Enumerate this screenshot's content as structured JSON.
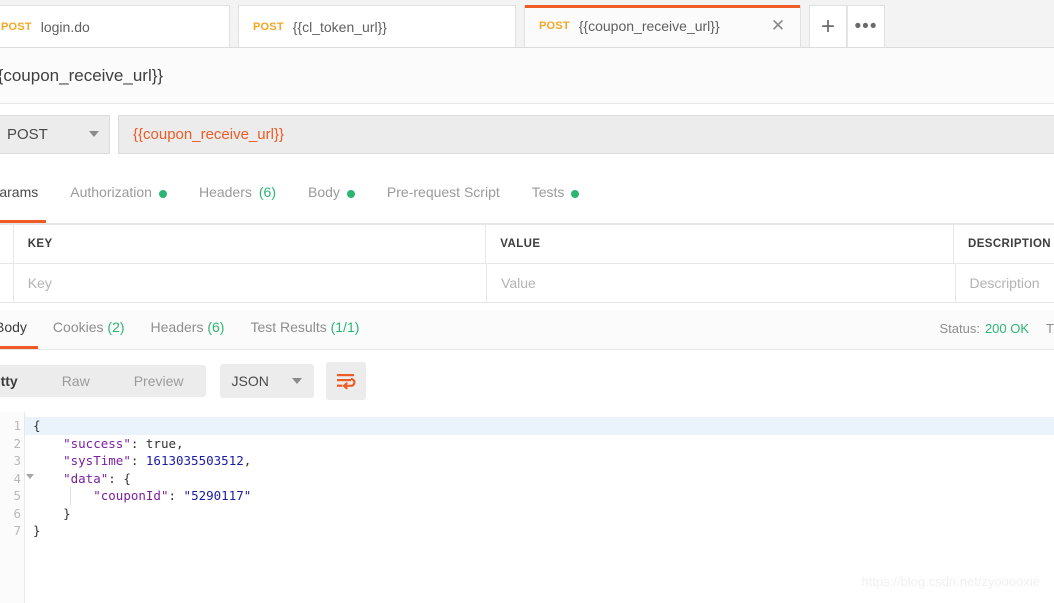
{
  "tabbar": {
    "tabs": [
      {
        "method": "POST",
        "title": "login.do",
        "active": false
      },
      {
        "method": "POST",
        "title": "{{cl_token_url}}",
        "active": false
      },
      {
        "method": "POST",
        "title": "{{coupon_receive_url}}",
        "active": true
      }
    ],
    "close_label": "✕",
    "new_tab_label": "+",
    "more_label": "•••"
  },
  "header": {
    "title": "{{coupon_receive_url}}"
  },
  "request": {
    "method": "POST",
    "url": "{{coupon_receive_url}}",
    "tabs": [
      {
        "label": "Params",
        "dot": false,
        "count": "",
        "active": true
      },
      {
        "label": "Authorization",
        "dot": true,
        "count": "",
        "active": false
      },
      {
        "label": "Headers",
        "dot": false,
        "count": "(6)",
        "active": false
      },
      {
        "label": "Body",
        "dot": true,
        "count": "",
        "active": false
      },
      {
        "label": "Pre-request Script",
        "dot": false,
        "count": "",
        "active": false
      },
      {
        "label": "Tests",
        "dot": true,
        "count": "",
        "active": false
      }
    ],
    "table": {
      "headers": {
        "key": "KEY",
        "value": "VALUE",
        "description": "DESCRIPTION"
      },
      "placeholders": {
        "key": "Key",
        "value": "Value",
        "description": "Description"
      }
    }
  },
  "response": {
    "tabs": [
      {
        "label": "Body",
        "count": "",
        "active": true
      },
      {
        "label": "Cookies",
        "count": "(2)",
        "active": false
      },
      {
        "label": "Headers",
        "count": "(6)",
        "active": false
      },
      {
        "label": "Test Results",
        "count": "(1/1)",
        "active": false
      }
    ],
    "status_label": "Status:",
    "status_value": "200 OK",
    "time_label": "T",
    "format_tabs": [
      {
        "label": "Pretty",
        "active": true
      },
      {
        "label": "Raw",
        "active": false
      },
      {
        "label": "Preview",
        "active": false
      }
    ],
    "language": "JSON",
    "wrap_icon": "word-wrap-icon",
    "body_lines": [
      {
        "num": "1",
        "fold": true,
        "text": "{"
      },
      {
        "num": "2",
        "fold": false,
        "text": "    \"success\": true,"
      },
      {
        "num": "3",
        "fold": false,
        "text": "    \"sysTime\": 1613035503512,"
      },
      {
        "num": "4",
        "fold": true,
        "text": "    \"data\": {"
      },
      {
        "num": "5",
        "fold": false,
        "text": "        \"couponId\": \"5290117\""
      },
      {
        "num": "6",
        "fold": false,
        "text": "    }"
      },
      {
        "num": "7",
        "fold": false,
        "text": "}"
      }
    ],
    "json": {
      "success": "true",
      "sysTime": "1613035503512",
      "data": {
        "couponId": "5290117"
      }
    }
  },
  "watermark": "https://blog.csdn.net/zyooooxie",
  "colors": {
    "accent": "#ef5b25",
    "method": "#f5a623",
    "success": "#2bb673"
  }
}
